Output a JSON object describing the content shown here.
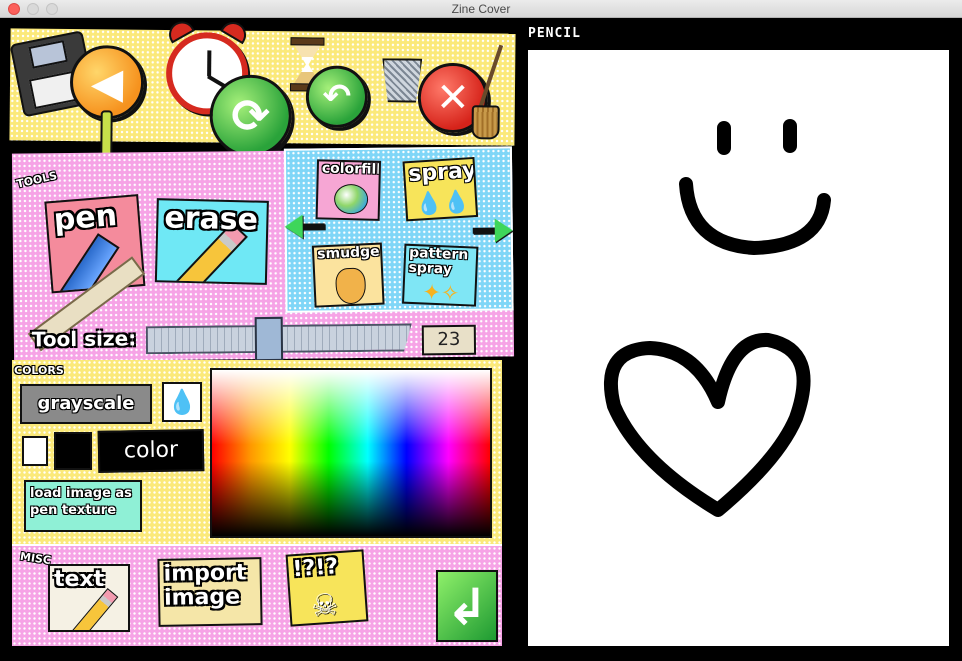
{
  "window": {
    "title": "Zine Cover"
  },
  "toolbar": {
    "icons": [
      "floppy-icon",
      "back-icon",
      "clock-icon",
      "redo-icon",
      "hourglass-icon",
      "undo-icon",
      "trash-icon",
      "cancel-icon",
      "broom-icon"
    ],
    "back_glyph": "◀",
    "redo_glyph": "⟳",
    "undo_glyph": "↶",
    "cancel_glyph": "✕"
  },
  "tools": {
    "section_label": "TOOLS",
    "pen_label": "pen",
    "erase_label": "erase",
    "subtools": {
      "colorfill_label": "colorfill",
      "spray_label": "spray",
      "smudge_label": "smudge",
      "pattern_spray_label": "pattern spray"
    },
    "tool_size_label": "Tool size:",
    "tool_size_value": "23",
    "tool_size_level": 0.46
  },
  "colors": {
    "section_label": "COLORS",
    "grayscale_label": "grayscale",
    "color_label": "color",
    "load_texture_label": "load image as pen texture",
    "current_color": "#000000"
  },
  "misc": {
    "section_label": "MISC",
    "text_label": "text",
    "import_image_label": "import image",
    "danger_label": "!?!?",
    "done_glyph": "↲"
  },
  "canvas": {
    "mode_label": "PENCIL",
    "stroke_color": "#000000",
    "background": "#ffffff"
  }
}
